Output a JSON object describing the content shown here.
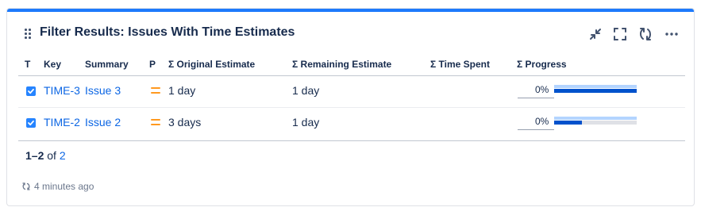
{
  "gadget": {
    "title": "Filter Results: Issues With Time Estimates",
    "icons": [
      "minimize-icon",
      "fullscreen-icon",
      "refresh-icon",
      "more-icon"
    ],
    "accent_color": "#1d7afc"
  },
  "table": {
    "columns": [
      "T",
      "Key",
      "Summary",
      "P",
      "Σ Original Estimate",
      "Σ Remaining Estimate",
      "Σ Time Spent",
      "Σ Progress"
    ],
    "rows": [
      {
        "type_icon": "task-icon",
        "key": "TIME-3",
        "summary": "Issue 3",
        "priority_icon": "priority-medium-icon",
        "original_estimate": "1 day",
        "remaining_estimate": "1 day",
        "time_spent": "",
        "progress_text": "0%",
        "remaining_fraction": 1.0
      },
      {
        "type_icon": "task-icon",
        "key": "TIME-2",
        "summary": "Issue 2",
        "priority_icon": "priority-medium-icon",
        "original_estimate": "3 days",
        "remaining_estimate": "1 day",
        "time_spent": "",
        "progress_text": "0%",
        "remaining_fraction": 0.333
      }
    ]
  },
  "pagination": {
    "range": "1–2",
    "of_label": "of",
    "total": "2"
  },
  "footer": {
    "refresh_icon": "refresh-small-icon",
    "updated": "4 minutes ago"
  },
  "colors": {
    "link": "#0c66e4",
    "checkbox": "#2684ff",
    "priority": "#ff991f",
    "estimate_bar": "#b3d4ff",
    "remaining_bar": "#0052cc"
  }
}
